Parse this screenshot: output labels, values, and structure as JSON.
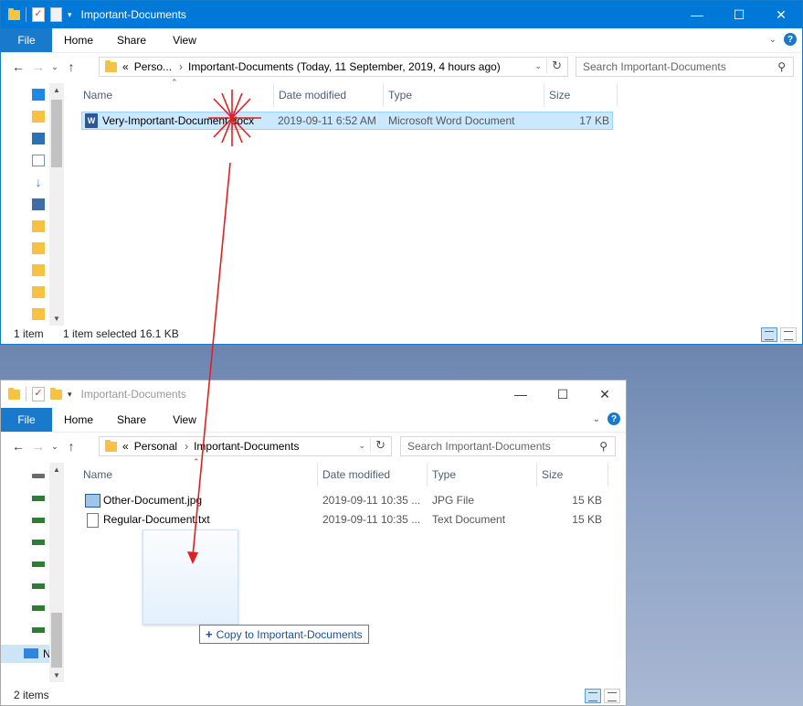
{
  "window1": {
    "title": "Important-Documents",
    "ribbon_tabs": [
      "File",
      "Home",
      "Share",
      "View"
    ],
    "breadcrumb": {
      "prefix": "«",
      "parent": "Perso...",
      "current": "Important-Documents (Today, 11 September, 2019, 4 hours ago)"
    },
    "search_placeholder": "Search Important-Documents",
    "columns": [
      "Name",
      "Date modified",
      "Type",
      "Size"
    ],
    "files": [
      {
        "name": "Very-Important-Document.docx",
        "date": "2019-09-11 6:52 AM",
        "type": "Microsoft Word Document",
        "size": "17 KB",
        "icon": "word-icon",
        "selected": true
      }
    ],
    "status": {
      "count": "1 item",
      "selected": "1 item selected  16.1 KB"
    }
  },
  "window2": {
    "title": "Important-Documents",
    "ribbon_tabs": [
      "File",
      "Home",
      "Share",
      "View"
    ],
    "breadcrumb": {
      "prefix": "«",
      "parent": "Personal",
      "current": "Important-Documents"
    },
    "search_placeholder": "Search Important-Documents",
    "columns": [
      "Name",
      "Date modified",
      "Type",
      "Size"
    ],
    "files": [
      {
        "name": "Other-Document.jpg",
        "date": "2019-09-11 10:35 ...",
        "type": "JPG File",
        "size": "15 KB",
        "icon": "image-file-icon"
      },
      {
        "name": "Regular-Document.txt",
        "date": "2019-09-11 10:35 ...",
        "type": "Text Document",
        "size": "15 KB",
        "icon": "text-file-icon"
      }
    ],
    "nav_partial_label": "N",
    "status": {
      "count": "2 items"
    }
  },
  "drag": {
    "tooltip": "Copy to Important-Documents"
  },
  "colors": {
    "titlebar": "#0078d7",
    "file_tab": "#1979ca",
    "selection": "#cce8ff",
    "drag_arrow": "#e02020"
  }
}
